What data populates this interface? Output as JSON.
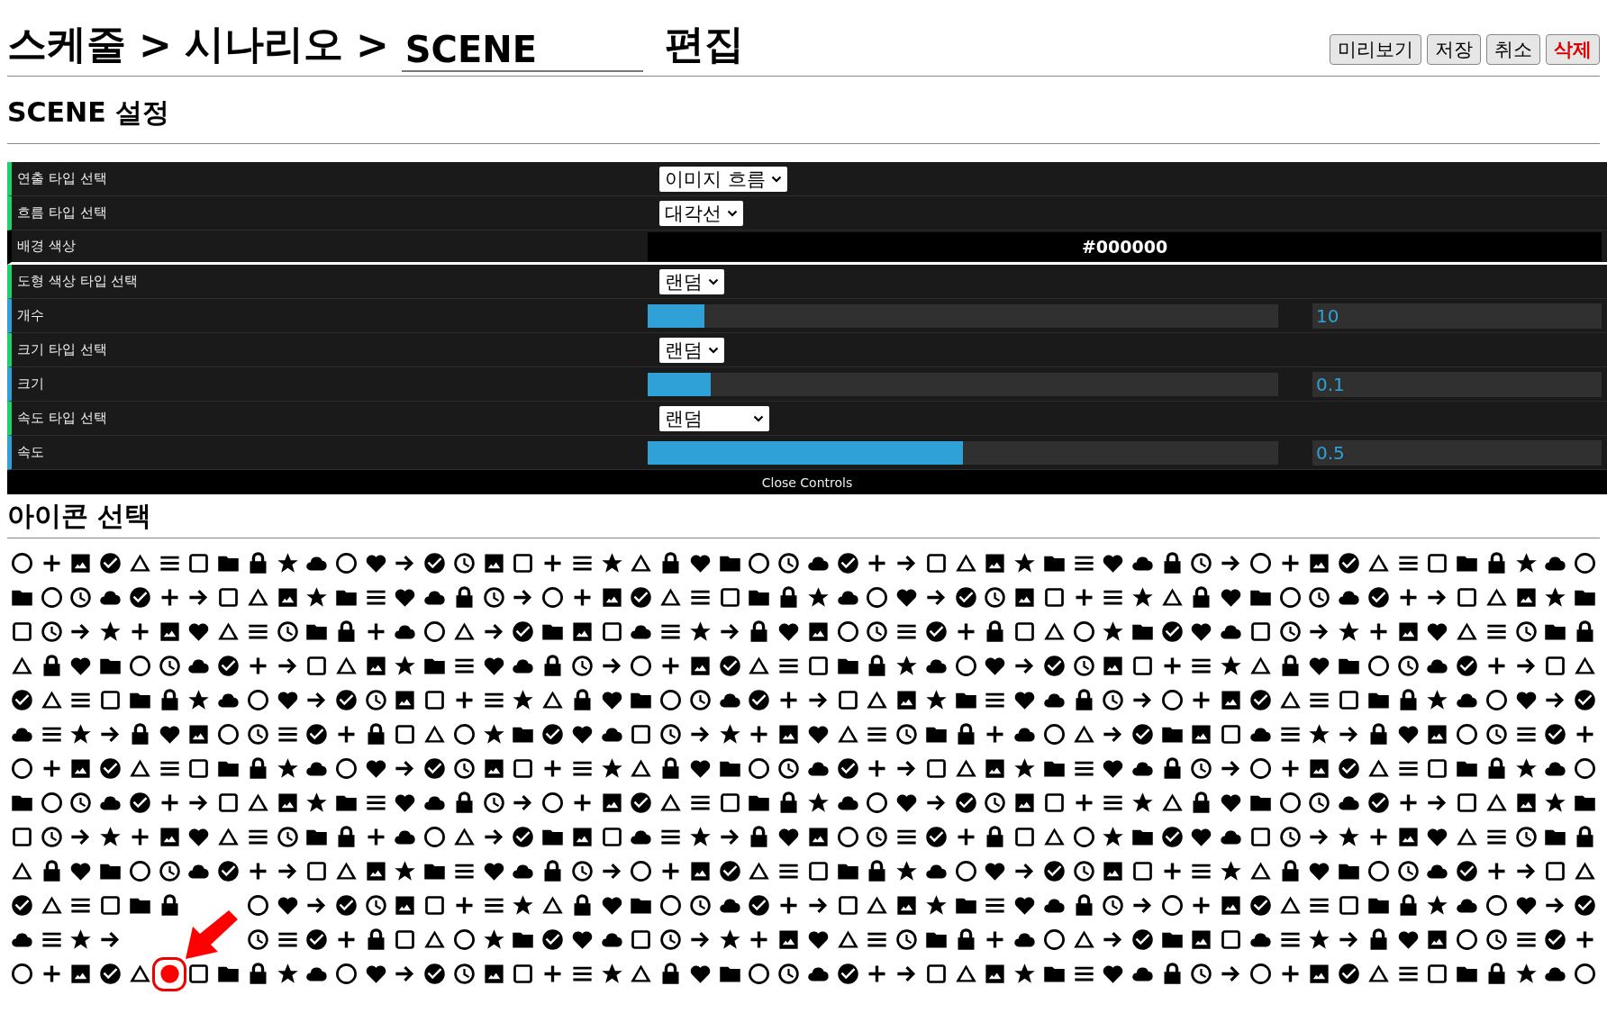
{
  "breadcrumb": [
    "스케줄",
    ">",
    "시나리오",
    ">"
  ],
  "name_field": {
    "value": "SCENE"
  },
  "title_suffix": "편집",
  "buttons": [
    {
      "label": "미리보기",
      "kind": "normal"
    },
    {
      "label": "저장",
      "kind": "normal"
    },
    {
      "label": "취소",
      "kind": "normal"
    },
    {
      "label": "삭제",
      "kind": "danger"
    }
  ],
  "section_title": "SCENE 설정",
  "controls": [
    {
      "kind": "select",
      "label": "연출 타입 선택",
      "value": "이미지 흐름"
    },
    {
      "kind": "select",
      "label": "흐름 타입 선택",
      "value": "대각선"
    },
    {
      "kind": "color",
      "label": "배경 색상",
      "value": "#000000"
    },
    {
      "kind": "select",
      "label": "도형 색상 타입 선택",
      "value": "랜덤"
    },
    {
      "kind": "slider",
      "label": "개수",
      "level": 0.09,
      "value": "10"
    },
    {
      "kind": "select",
      "label": "크기 타입 선택",
      "value": "랜덤"
    },
    {
      "kind": "slider",
      "label": "크기",
      "level": 0.1,
      "value": "0.1"
    },
    {
      "kind": "select",
      "label": "속도 타입 선택",
      "value": "랜덤"
    },
    {
      "kind": "slider",
      "label": "속도",
      "level": 0.5,
      "value": "0.5"
    }
  ],
  "close_button": "Close Controls",
  "icon_section_title": "아이콘 선택"
}
